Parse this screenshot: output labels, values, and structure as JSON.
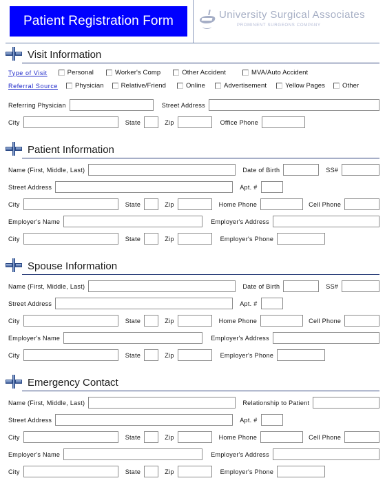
{
  "header": {
    "form_title": "Patient Registration Form",
    "logo_name": "University Surgical Associates",
    "logo_tagline": "PROMINENT SURGEONS COMPANY",
    "title_bg": "#0000FF",
    "title_color": "#FFFFFF"
  },
  "common_labels": {
    "name": "Name  (First,  Middle,  Last)",
    "date_of_birth": "Date  of Birth",
    "ss": "SS#",
    "street_address": "Street  Address",
    "apt": "Apt. #",
    "city": "City",
    "state": "State",
    "zip": "Zip",
    "home_phone": "Home  Phone",
    "cell_phone": "Cell  Phone",
    "employers_name": "Employer's  Name",
    "employers_address": "Employer's  Address",
    "employers_phone": "Employer's  Phone",
    "relationship_to_patient": "Relationship  to Patient"
  },
  "sections": [
    {
      "id": "visit-information",
      "title": "Visit Information",
      "icon": "medical-cross-icon",
      "checkbox_groups": [
        {
          "id": "type-of-visit",
          "label": "Type  of Visit",
          "label_color": "#1C27C9",
          "options": [
            {
              "label": "Personal",
              "checked": false
            },
            {
              "label": "Worker's Comp",
              "checked": false
            },
            {
              "label": "Other  Accident",
              "checked": false
            },
            {
              "label": "MVA/Auto Accident",
              "checked": false
            }
          ]
        },
        {
          "id": "referral-source",
          "label": "Referral  Source",
          "label_color": "#1C27C9",
          "options": [
            {
              "label": "Physician",
              "checked": false
            },
            {
              "label": "Relative/Friend",
              "checked": false
            },
            {
              "label": "Online",
              "checked": false
            },
            {
              "label": "Advertisement",
              "checked": false
            },
            {
              "label": "Yellow Pages",
              "checked": false
            },
            {
              "label": "Other",
              "checked": false
            }
          ]
        }
      ],
      "fields": {
        "referring_physician": "Referring  Physician",
        "street_address": "Street  Address",
        "office_phone": "Office  Phone"
      },
      "values": {
        "referring_physician": "",
        "street_address": "",
        "city": "",
        "state": "",
        "zip": "",
        "office_phone": ""
      }
    },
    {
      "id": "patient-information",
      "title": "Patient Information",
      "icon": "medical-cross-icon",
      "values": {
        "name": "",
        "date_of_birth": "",
        "ss": "",
        "street_address": "",
        "apt": "",
        "city": "",
        "state": "",
        "zip": "",
        "home_phone": "",
        "cell_phone": "",
        "employers_name": "",
        "employers_address": "",
        "emp_city": "",
        "emp_state": "",
        "emp_zip": "",
        "employers_phone": ""
      }
    },
    {
      "id": "spouse-information",
      "title": "Spouse Information",
      "icon": "medical-cross-icon",
      "values": {
        "name": "",
        "date_of_birth": "",
        "ss": "",
        "street_address": "",
        "apt": "",
        "city": "",
        "state": "",
        "zip": "",
        "home_phone": "",
        "cell_phone": "",
        "employers_name": "",
        "employers_address": "",
        "emp_city": "",
        "emp_state": "",
        "emp_zip": "",
        "employers_phone": ""
      }
    },
    {
      "id": "emergency-contact",
      "title": "Emergency Contact",
      "icon": "medical-cross-icon",
      "values": {
        "name": "",
        "relationship_to_patient": "",
        "street_address": "",
        "apt": "",
        "city": "",
        "state": "",
        "zip": "",
        "home_phone": "",
        "cell_phone": "",
        "employers_name": "",
        "employers_address": "",
        "emp_city": "",
        "emp_state": "",
        "emp_zip": "",
        "employers_phone": ""
      }
    }
  ]
}
